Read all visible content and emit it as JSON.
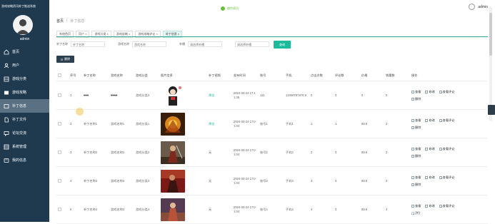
{
  "app": {
    "title": "游戏攻略资讯补丁推送系统",
    "user": "admin"
  },
  "header": {
    "toast": "操作成功",
    "user": "admin"
  },
  "sidebar": {
    "items": [
      {
        "label": "首页",
        "icon": "home-icon"
      },
      {
        "label": "用户",
        "icon": "user-icon"
      },
      {
        "label": "游戏分类",
        "icon": "tag-icon"
      },
      {
        "label": "游戏攻略",
        "icon": "book-icon"
      },
      {
        "label": "补丁信息",
        "icon": "patch-icon",
        "active": true
      },
      {
        "label": "补丁文件",
        "icon": "file-icon"
      },
      {
        "label": "论坛交流",
        "icon": "chat-icon"
      },
      {
        "label": "系统管理",
        "icon": "settings-icon"
      },
      {
        "label": "我的信息",
        "icon": "profile-icon"
      }
    ]
  },
  "breadcrumb": {
    "home": "首页",
    "sep": "/",
    "current": "补丁信息"
  },
  "tabs": [
    {
      "label": "系统首页",
      "closable": false
    },
    {
      "label": "用户",
      "closable": true
    },
    {
      "label": "游戏分类",
      "closable": true
    },
    {
      "label": "游戏攻略",
      "closable": true
    },
    {
      "label": "游戏攻略评论",
      "closable": true
    },
    {
      "label": "补丁信息",
      "closable": true,
      "active": true
    }
  ],
  "search": {
    "fields": [
      {
        "label": "补丁名称",
        "placeholder": "补丁名称"
      },
      {
        "label": "游戏名称",
        "placeholder": "游戏名称"
      },
      {
        "label": "补槽",
        "placeholder": "请选择补槽"
      },
      {
        "label": "",
        "placeholder": "请选择补槽"
      }
    ],
    "button": "查询"
  },
  "actions": {
    "delete": "删除"
  },
  "table": {
    "headers": [
      "序号",
      "补丁名称",
      "游戏名称",
      "游戏分类",
      "图片信息",
      "补丁视频",
      "发布时间",
      "账号",
      "手机",
      "点击次数",
      "评论数",
      "价格",
      "销量数",
      "操作"
    ],
    "rows": [
      {
        "no": "1",
        "name": "666",
        "game": "6666",
        "category": "游戏分类3",
        "img": "img-anime",
        "video": "预览",
        "time": "2024-04-24 17:11:35",
        "account": "111",
        "phone": "13450787876 5",
        "clicks": "0",
        "comments": "0",
        "price": "0",
        "sales": "0",
        "struck": true
      },
      {
        "no": "2",
        "name": "补丁名称1",
        "game": "游戏名称1",
        "category": "游戏分类1",
        "img": "img-bird",
        "video": "预览",
        "time": "2024-04-24 17:01:04",
        "account": "账号1",
        "phone": "手机1",
        "clicks": "1",
        "comments": "1",
        "price": "99.9",
        "sales": "2",
        "struck": false
      },
      {
        "no": "3",
        "name": "补丁名称2",
        "game": "游戏名称2",
        "category": "游戏分类2",
        "img": "img-warrior",
        "video": "无",
        "time": "2024-04-24 17:01:04",
        "account": "账号2",
        "phone": "手机2",
        "clicks": "2",
        "comments": "0",
        "price": "99.9",
        "sales": "2",
        "struck": false
      },
      {
        "no": "4",
        "name": "补丁名称3",
        "game": "游戏名称3",
        "category": "游戏分类3",
        "img": "img-red",
        "video": "无",
        "time": "2024-04-24 17:01:04",
        "account": "账号3",
        "phone": "手机3",
        "clicks": "3",
        "comments": "0",
        "price": "99.9",
        "sales": "3",
        "struck": false
      },
      {
        "no": "5",
        "name": "补丁名称4",
        "game": "游戏名称4",
        "category": "游戏分类4",
        "img": "img-hero",
        "video": "无",
        "time": "2024-04-24 17:01:04",
        "account": "账号4",
        "phone": "手机4",
        "clicks": "4",
        "comments": "0",
        "price": "99.9",
        "sales": "4",
        "struck": false
      }
    ],
    "row_actions": {
      "view": "查看",
      "edit": "修改",
      "comments": "查看评论",
      "delete": "删除"
    }
  },
  "watermark": "CSDN @django 毕业设计",
  "colors": {
    "sidebar": "#1f3a4f",
    "sidebar_active": "#5a7184",
    "accent": "#1abc9c",
    "toast": "#67c23a"
  }
}
